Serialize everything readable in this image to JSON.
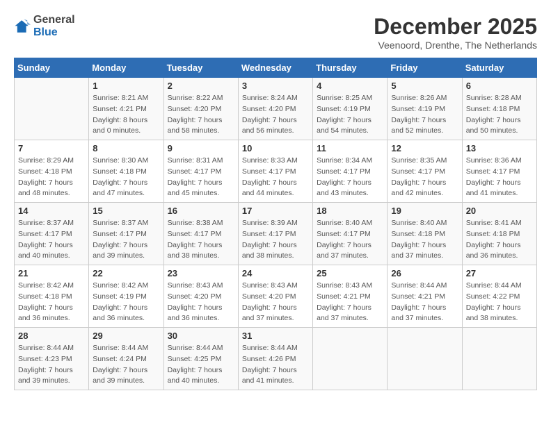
{
  "header": {
    "logo": {
      "general": "General",
      "blue": "Blue"
    },
    "title": "December 2025",
    "location": "Veenoord, Drenthe, The Netherlands"
  },
  "days_of_week": [
    "Sunday",
    "Monday",
    "Tuesday",
    "Wednesday",
    "Thursday",
    "Friday",
    "Saturday"
  ],
  "weeks": [
    [
      {
        "day": "",
        "sunrise": "",
        "sunset": "",
        "daylight": ""
      },
      {
        "day": "1",
        "sunrise": "Sunrise: 8:21 AM",
        "sunset": "Sunset: 4:21 PM",
        "daylight": "Daylight: 8 hours and 0 minutes."
      },
      {
        "day": "2",
        "sunrise": "Sunrise: 8:22 AM",
        "sunset": "Sunset: 4:20 PM",
        "daylight": "Daylight: 7 hours and 58 minutes."
      },
      {
        "day": "3",
        "sunrise": "Sunrise: 8:24 AM",
        "sunset": "Sunset: 4:20 PM",
        "daylight": "Daylight: 7 hours and 56 minutes."
      },
      {
        "day": "4",
        "sunrise": "Sunrise: 8:25 AM",
        "sunset": "Sunset: 4:19 PM",
        "daylight": "Daylight: 7 hours and 54 minutes."
      },
      {
        "day": "5",
        "sunrise": "Sunrise: 8:26 AM",
        "sunset": "Sunset: 4:19 PM",
        "daylight": "Daylight: 7 hours and 52 minutes."
      },
      {
        "day": "6",
        "sunrise": "Sunrise: 8:28 AM",
        "sunset": "Sunset: 4:18 PM",
        "daylight": "Daylight: 7 hours and 50 minutes."
      }
    ],
    [
      {
        "day": "7",
        "sunrise": "Sunrise: 8:29 AM",
        "sunset": "Sunset: 4:18 PM",
        "daylight": "Daylight: 7 hours and 48 minutes."
      },
      {
        "day": "8",
        "sunrise": "Sunrise: 8:30 AM",
        "sunset": "Sunset: 4:18 PM",
        "daylight": "Daylight: 7 hours and 47 minutes."
      },
      {
        "day": "9",
        "sunrise": "Sunrise: 8:31 AM",
        "sunset": "Sunset: 4:17 PM",
        "daylight": "Daylight: 7 hours and 45 minutes."
      },
      {
        "day": "10",
        "sunrise": "Sunrise: 8:33 AM",
        "sunset": "Sunset: 4:17 PM",
        "daylight": "Daylight: 7 hours and 44 minutes."
      },
      {
        "day": "11",
        "sunrise": "Sunrise: 8:34 AM",
        "sunset": "Sunset: 4:17 PM",
        "daylight": "Daylight: 7 hours and 43 minutes."
      },
      {
        "day": "12",
        "sunrise": "Sunrise: 8:35 AM",
        "sunset": "Sunset: 4:17 PM",
        "daylight": "Daylight: 7 hours and 42 minutes."
      },
      {
        "day": "13",
        "sunrise": "Sunrise: 8:36 AM",
        "sunset": "Sunset: 4:17 PM",
        "daylight": "Daylight: 7 hours and 41 minutes."
      }
    ],
    [
      {
        "day": "14",
        "sunrise": "Sunrise: 8:37 AM",
        "sunset": "Sunset: 4:17 PM",
        "daylight": "Daylight: 7 hours and 40 minutes."
      },
      {
        "day": "15",
        "sunrise": "Sunrise: 8:37 AM",
        "sunset": "Sunset: 4:17 PM",
        "daylight": "Daylight: 7 hours and 39 minutes."
      },
      {
        "day": "16",
        "sunrise": "Sunrise: 8:38 AM",
        "sunset": "Sunset: 4:17 PM",
        "daylight": "Daylight: 7 hours and 38 minutes."
      },
      {
        "day": "17",
        "sunrise": "Sunrise: 8:39 AM",
        "sunset": "Sunset: 4:17 PM",
        "daylight": "Daylight: 7 hours and 38 minutes."
      },
      {
        "day": "18",
        "sunrise": "Sunrise: 8:40 AM",
        "sunset": "Sunset: 4:17 PM",
        "daylight": "Daylight: 7 hours and 37 minutes."
      },
      {
        "day": "19",
        "sunrise": "Sunrise: 8:40 AM",
        "sunset": "Sunset: 4:18 PM",
        "daylight": "Daylight: 7 hours and 37 minutes."
      },
      {
        "day": "20",
        "sunrise": "Sunrise: 8:41 AM",
        "sunset": "Sunset: 4:18 PM",
        "daylight": "Daylight: 7 hours and 36 minutes."
      }
    ],
    [
      {
        "day": "21",
        "sunrise": "Sunrise: 8:42 AM",
        "sunset": "Sunset: 4:18 PM",
        "daylight": "Daylight: 7 hours and 36 minutes."
      },
      {
        "day": "22",
        "sunrise": "Sunrise: 8:42 AM",
        "sunset": "Sunset: 4:19 PM",
        "daylight": "Daylight: 7 hours and 36 minutes."
      },
      {
        "day": "23",
        "sunrise": "Sunrise: 8:43 AM",
        "sunset": "Sunset: 4:20 PM",
        "daylight": "Daylight: 7 hours and 36 minutes."
      },
      {
        "day": "24",
        "sunrise": "Sunrise: 8:43 AM",
        "sunset": "Sunset: 4:20 PM",
        "daylight": "Daylight: 7 hours and 37 minutes."
      },
      {
        "day": "25",
        "sunrise": "Sunrise: 8:43 AM",
        "sunset": "Sunset: 4:21 PM",
        "daylight": "Daylight: 7 hours and 37 minutes."
      },
      {
        "day": "26",
        "sunrise": "Sunrise: 8:44 AM",
        "sunset": "Sunset: 4:21 PM",
        "daylight": "Daylight: 7 hours and 37 minutes."
      },
      {
        "day": "27",
        "sunrise": "Sunrise: 8:44 AM",
        "sunset": "Sunset: 4:22 PM",
        "daylight": "Daylight: 7 hours and 38 minutes."
      }
    ],
    [
      {
        "day": "28",
        "sunrise": "Sunrise: 8:44 AM",
        "sunset": "Sunset: 4:23 PM",
        "daylight": "Daylight: 7 hours and 39 minutes."
      },
      {
        "day": "29",
        "sunrise": "Sunrise: 8:44 AM",
        "sunset": "Sunset: 4:24 PM",
        "daylight": "Daylight: 7 hours and 39 minutes."
      },
      {
        "day": "30",
        "sunrise": "Sunrise: 8:44 AM",
        "sunset": "Sunset: 4:25 PM",
        "daylight": "Daylight: 7 hours and 40 minutes."
      },
      {
        "day": "31",
        "sunrise": "Sunrise: 8:44 AM",
        "sunset": "Sunset: 4:26 PM",
        "daylight": "Daylight: 7 hours and 41 minutes."
      },
      {
        "day": "",
        "sunrise": "",
        "sunset": "",
        "daylight": ""
      },
      {
        "day": "",
        "sunrise": "",
        "sunset": "",
        "daylight": ""
      },
      {
        "day": "",
        "sunrise": "",
        "sunset": "",
        "daylight": ""
      }
    ]
  ]
}
